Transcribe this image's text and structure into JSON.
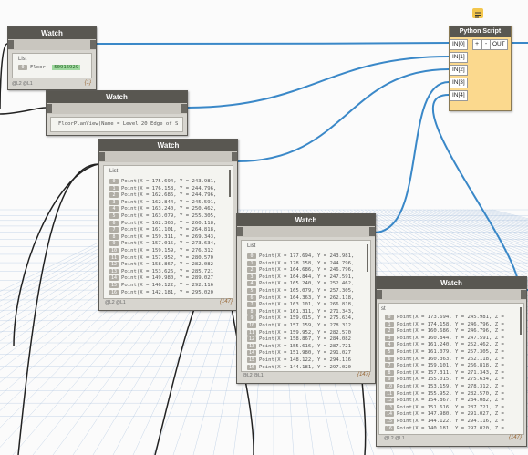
{
  "python_node": {
    "title": "Python Script",
    "inputs": [
      "IN[0]",
      "IN[1]",
      "IN[2]",
      "IN[3]",
      "IN[4]"
    ],
    "add_button": "+",
    "remove_button": "-",
    "output": "OUT"
  },
  "watch1": {
    "title": "Watch",
    "list_label": "List",
    "item_index": "0",
    "item_type": "Floor",
    "item_value": "50916929",
    "footer": "@L2 @L1",
    "count": "{1}"
  },
  "watch2": {
    "title": "Watch",
    "value": "FloorPlanView(Name = Level 20 Edge of S"
  },
  "watch3": {
    "title": "Watch",
    "list_label": "List",
    "footer": "@L2 @L1",
    "count": "{147}",
    "rows": [
      {
        "i": "0",
        "t": "Point(X = 175.694, Y = 243.981,"
      },
      {
        "i": "1",
        "t": "Point(X = 176.158, Y = 244.796,"
      },
      {
        "i": "2",
        "t": "Point(X = 162.686, Y = 244.796,"
      },
      {
        "i": "3",
        "t": "Point(X = 162.844, Y = 245.591,"
      },
      {
        "i": "4",
        "t": "Point(X = 163.240, Y = 250.462,"
      },
      {
        "i": "5",
        "t": "Point(X = 163.079, Y = 255.305,"
      },
      {
        "i": "6",
        "t": "Point(X = 162.363, Y = 260.118,"
      },
      {
        "i": "7",
        "t": "Point(X = 161.101, Y = 264.818,"
      },
      {
        "i": "8",
        "t": "Point(X = 159.311, Y = 269.343,"
      },
      {
        "i": "9",
        "t": "Point(X = 157.015, Y = 273.634,"
      },
      {
        "i": "10",
        "t": "Point(X = 159.159, Y = 276.312"
      },
      {
        "i": "11",
        "t": "Point(X = 157.952, Y = 280.570"
      },
      {
        "i": "12",
        "t": "Point(X = 158.867, Y = 282.082"
      },
      {
        "i": "13",
        "t": "Point(X = 153.626, Y = 285.721"
      },
      {
        "i": "14",
        "t": "Point(X = 149.980, Y = 289.027"
      },
      {
        "i": "15",
        "t": "Point(X = 146.122, Y = 292.116"
      },
      {
        "i": "16",
        "t": "Point(X = 142.181, Y = 295.020"
      }
    ]
  },
  "watch4": {
    "title": "Watch",
    "list_label": "List",
    "footer": "@L2 @L1",
    "count": "{147}",
    "rows": [
      {
        "i": "0",
        "t": "Point(X = 177.694, Y = 243.981,"
      },
      {
        "i": "1",
        "t": "Point(X = 178.158, Y = 244.796,"
      },
      {
        "i": "2",
        "t": "Point(X = 164.686, Y = 246.796,"
      },
      {
        "i": "3",
        "t": "Point(X = 164.844, Y = 247.591,"
      },
      {
        "i": "4",
        "t": "Point(X = 165.240, Y = 252.462,"
      },
      {
        "i": "5",
        "t": "Point(X = 165.079, Y = 257.305,"
      },
      {
        "i": "6",
        "t": "Point(X = 164.363, Y = 262.118,"
      },
      {
        "i": "7",
        "t": "Point(X = 163.101, Y = 266.818,"
      },
      {
        "i": "8",
        "t": "Point(X = 161.311, Y = 271.343,"
      },
      {
        "i": "9",
        "t": "Point(X = 159.015, Y = 275.634,"
      },
      {
        "i": "10",
        "t": "Point(X = 157.159, Y = 278.312"
      },
      {
        "i": "11",
        "t": "Point(X = 159.952, Y = 282.570"
      },
      {
        "i": "12",
        "t": "Point(X = 158.867, Y = 284.082"
      },
      {
        "i": "13",
        "t": "Point(X = 155.616, Y = 287.721"
      },
      {
        "i": "14",
        "t": "Point(X = 151.980, Y = 291.027"
      },
      {
        "i": "15",
        "t": "Point(X = 148.122, Y = 294.116"
      },
      {
        "i": "16",
        "t": "Point(X = 144.181, Y = 297.020"
      }
    ]
  },
  "watch5": {
    "title": "Watch",
    "list_label": "st",
    "footer": "@L2 @L1",
    "count": "{147}",
    "rows": [
      {
        "i": "0",
        "t": "Point(X = 173.694, Y = 245.981, Z ="
      },
      {
        "i": "1",
        "t": "Point(X = 174.158, Y = 246.796, Z ="
      },
      {
        "i": "2",
        "t": "Point(X = 160.686, Y = 246.796, Z ="
      },
      {
        "i": "3",
        "t": "Point(X = 160.844, Y = 247.591, Z ="
      },
      {
        "i": "4",
        "t": "Point(X = 161.240, Y = 252.462, Z ="
      },
      {
        "i": "5",
        "t": "Point(X = 161.079, Y = 257.305, Z ="
      },
      {
        "i": "6",
        "t": "Point(X = 160.363, Y = 262.118, Z ="
      },
      {
        "i": "7",
        "t": "Point(X = 159.101, Y = 266.818, Z ="
      },
      {
        "i": "8",
        "t": "Point(X = 157.311, Y = 271.343, Z ="
      },
      {
        "i": "9",
        "t": "Point(X = 155.015, Y = 275.634, Z ="
      },
      {
        "i": "10",
        "t": "Point(X = 153.159, Y = 278.312, Z ="
      },
      {
        "i": "11",
        "t": "Point(X = 155.952, Y = 282.570, Z ="
      },
      {
        "i": "12",
        "t": "Point(X = 154.867, Y = 284.082, Z ="
      },
      {
        "i": "13",
        "t": "Point(X = 151.616, Y = 287.721, Z ="
      },
      {
        "i": "14",
        "t": "Point(X = 147.980, Y = 291.027, Z ="
      },
      {
        "i": "15",
        "t": "Point(X = 144.122, Y = 294.116, Z ="
      },
      {
        "i": "16",
        "t": "Point(X = 140.181, Y = 297.020, Z ="
      }
    ]
  },
  "colors": {
    "wire": "#3a88c8",
    "wire_dark": "#222222",
    "node_header": "#595751",
    "python_body": "#fbd98e",
    "grid": "#9ab6d8"
  }
}
